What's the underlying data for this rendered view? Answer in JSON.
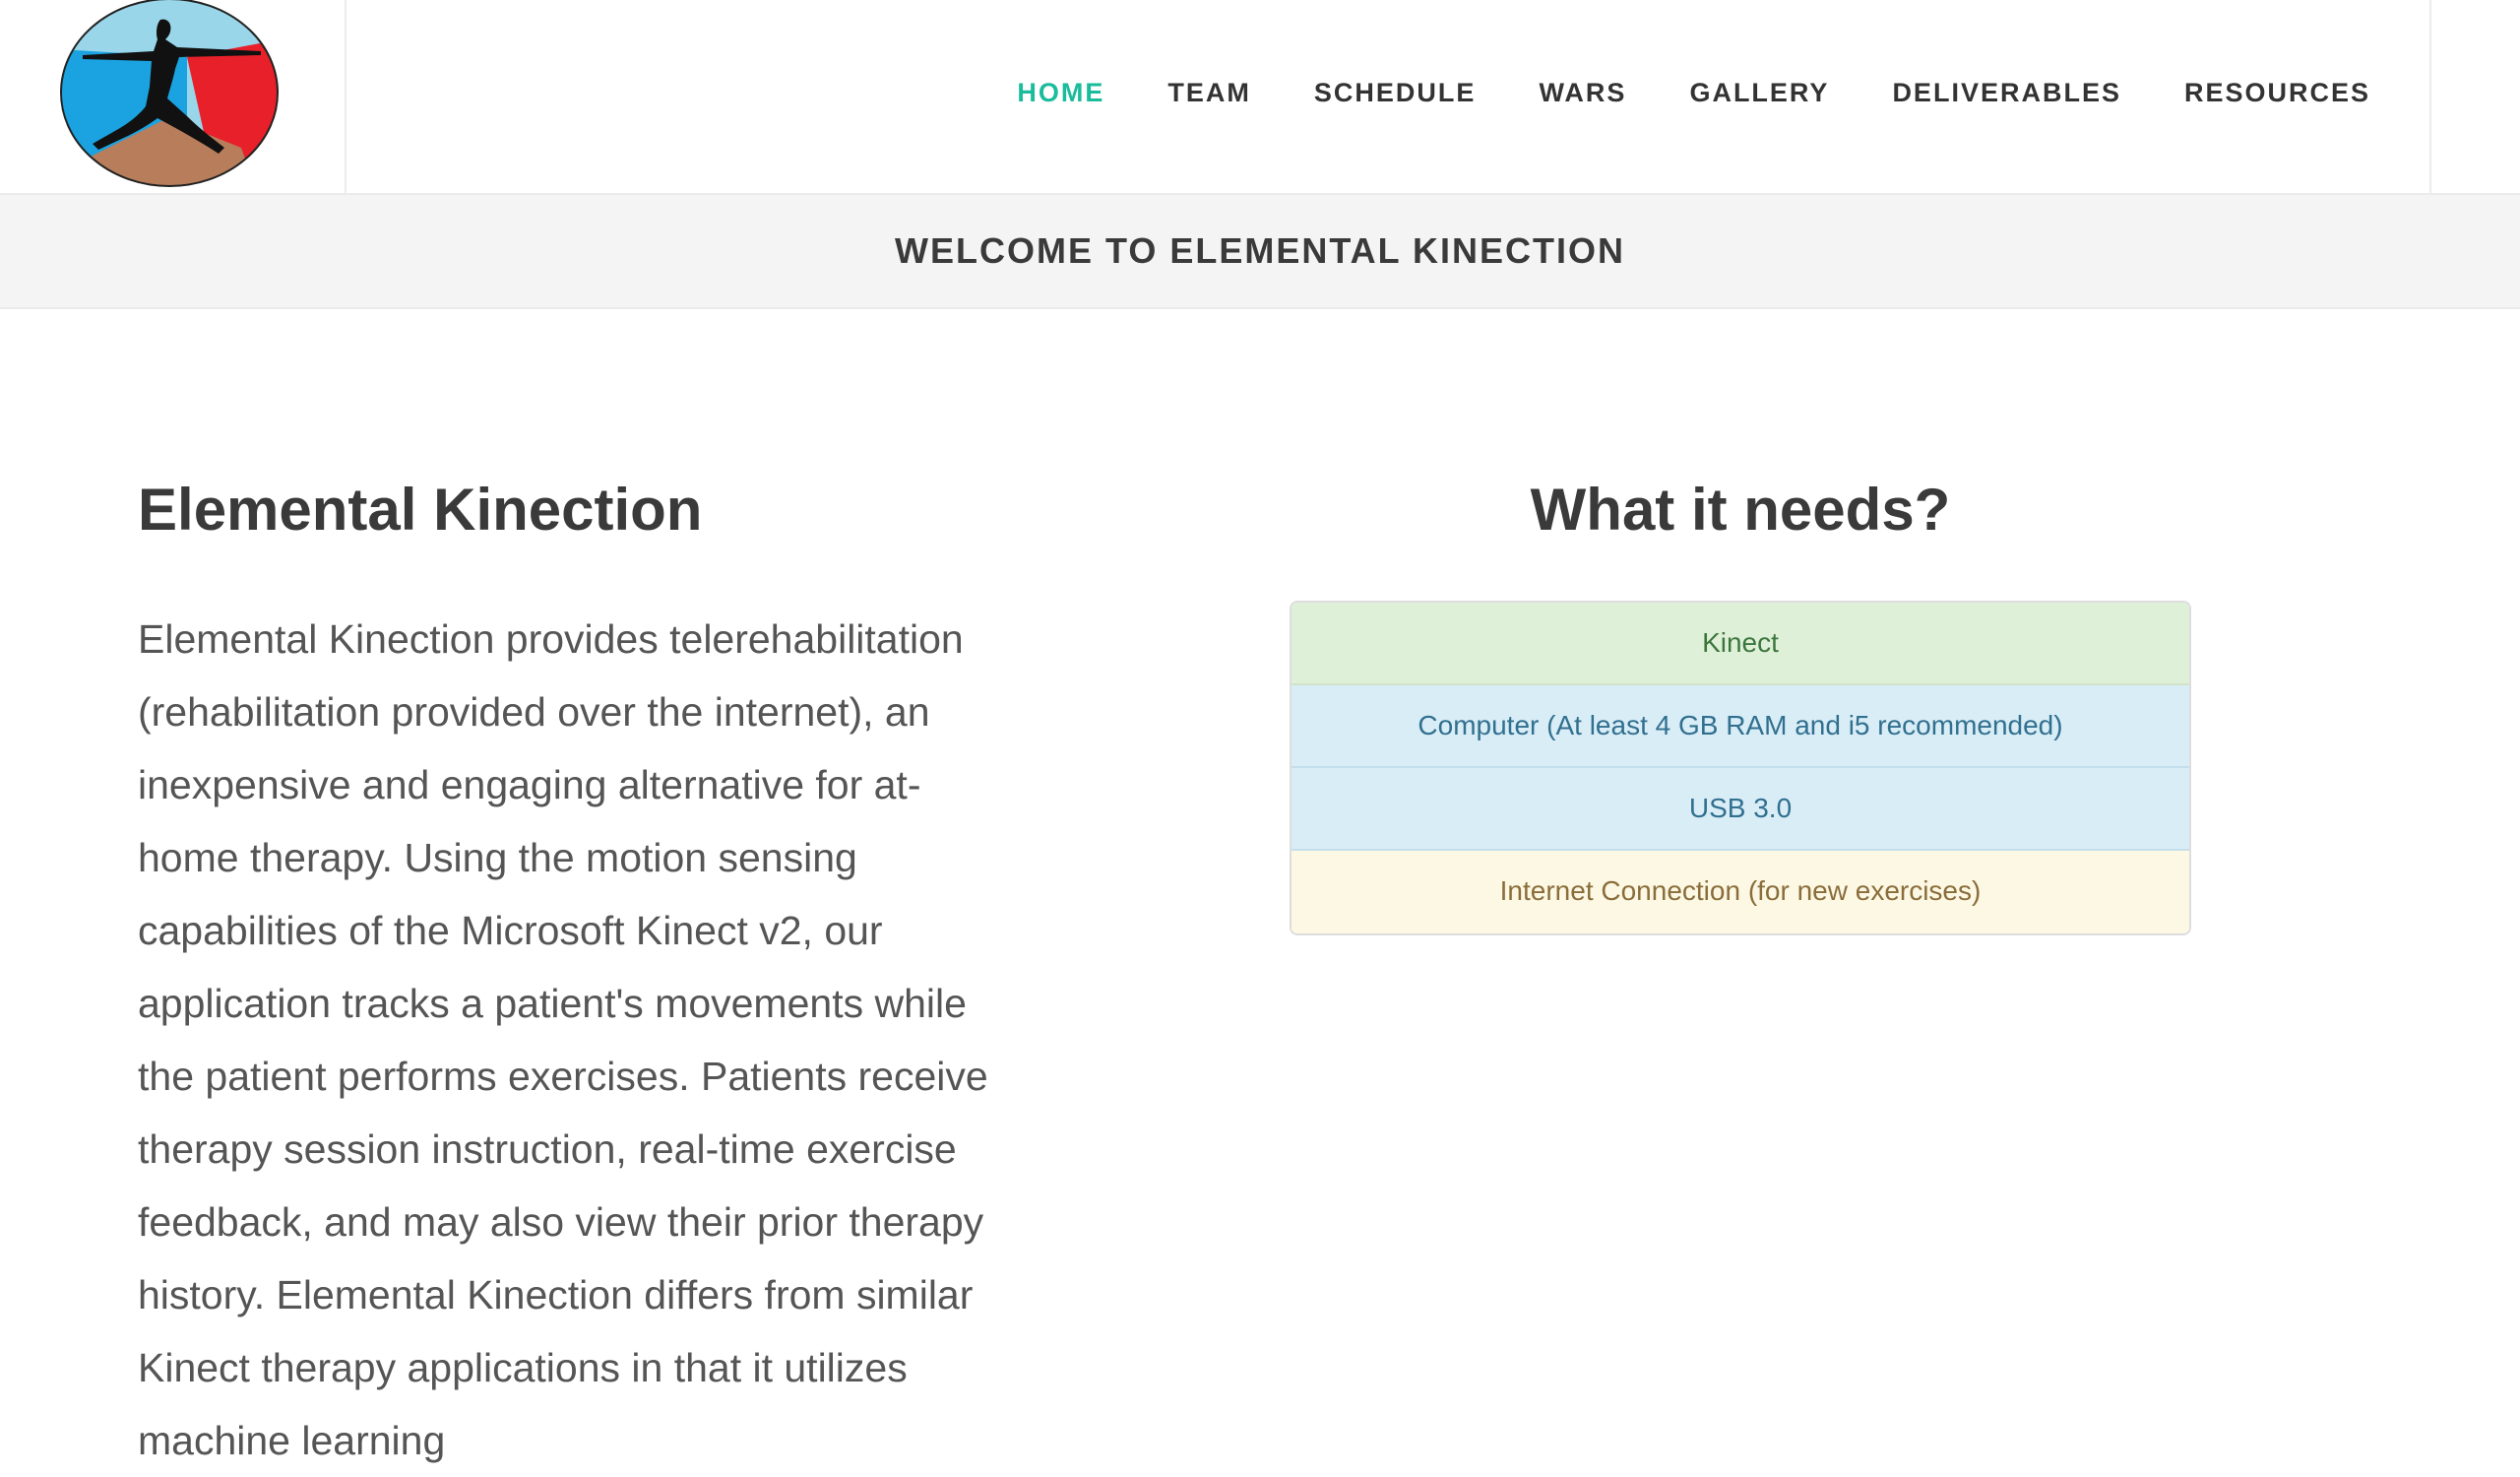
{
  "header": {
    "logo_alt": "Elemental Kinection logo",
    "nav": [
      {
        "label": "HOME",
        "active": true
      },
      {
        "label": "TEAM",
        "active": false
      },
      {
        "label": "SCHEDULE",
        "active": false
      },
      {
        "label": "WARS",
        "active": false
      },
      {
        "label": "GALLERY",
        "active": false
      },
      {
        "label": "DELIVERABLES",
        "active": false
      },
      {
        "label": "RESOURCES",
        "active": false
      }
    ],
    "active_color": "#1abc9c"
  },
  "welcome": {
    "title": "WELCOME TO ELEMENTAL KINECTION"
  },
  "about": {
    "heading": "Elemental Kinection",
    "body": "Elemental Kinection provides telerehabilitation (rehabilitation provided over the internet), an inexpensive and engaging alternative for at-home therapy. Using the motion sensing capabilities of the Microsoft Kinect v2, our application tracks a patient's movements while the patient performs exercises. Patients receive therapy session instruction, real-time exercise feedback, and may also view their prior therapy history. Elemental Kinection differs from similar Kinect therapy applications in that it utilizes machine learning"
  },
  "needs": {
    "heading": "What it needs?",
    "items": [
      {
        "label": "Kinect",
        "style": "success"
      },
      {
        "label": "Computer (At least 4 GB RAM and i5 recommended)",
        "style": "info"
      },
      {
        "label": "USB 3.0",
        "style": "info"
      },
      {
        "label": "Internet Connection (for new exercises)",
        "style": "warning"
      }
    ]
  }
}
